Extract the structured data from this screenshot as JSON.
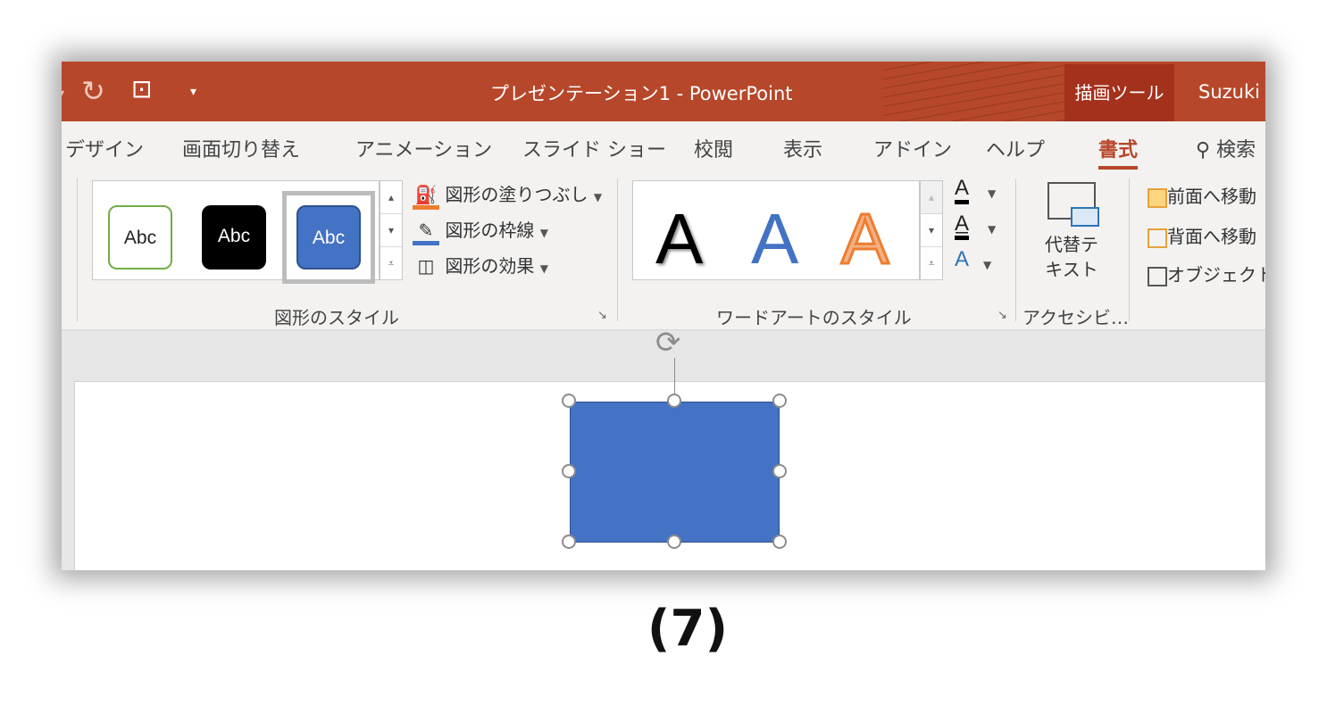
{
  "app": {
    "title": "プレゼンテーション1  -  PowerPoint",
    "context_tab": "描画ツール",
    "user": "Suzuki"
  },
  "tabs": [
    "デザイン",
    "画面切り替え",
    "アニメーション",
    "スライド ショー",
    "校閲",
    "表示",
    "アドイン",
    "ヘルプ",
    "書式",
    "検索"
  ],
  "active_tab": "書式",
  "shape_styles": {
    "swatches": [
      "Abc",
      "Abc",
      "Abc"
    ],
    "fill": "図形の塗りつぶし",
    "outline": "図形の枠線",
    "effects": "図形の効果",
    "group_label": "図形のスタイル"
  },
  "wordart": {
    "samples": [
      "A",
      "A",
      "A"
    ],
    "group_label": "ワードアートのスタイル"
  },
  "accessibility": {
    "alt_text_line1": "代替テ",
    "alt_text_line2": "キスト",
    "group_label": "アクセシビ…"
  },
  "arrange": {
    "bring_forward": "前面へ移動",
    "send_backward": "背面へ移動",
    "selection_pane": "オブジェクト"
  },
  "colors": {
    "accent": "#b7472a",
    "shape_fill": "#4472c4"
  },
  "caption": "(7)"
}
